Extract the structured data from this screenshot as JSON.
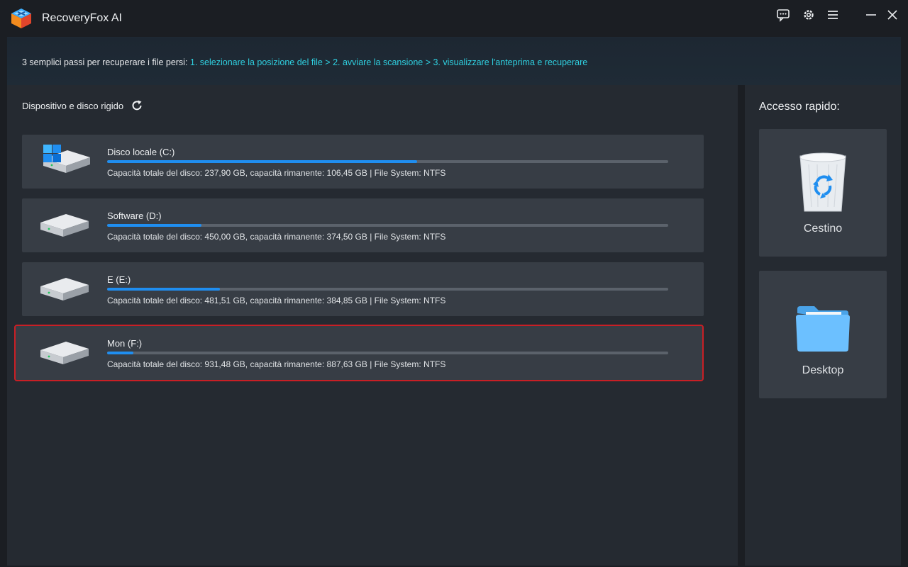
{
  "app": {
    "title": "RecoveryFox AI"
  },
  "titlebar": {
    "icons": [
      "feedback-icon",
      "gear-icon",
      "menu-icon",
      "minimize-icon",
      "close-icon"
    ]
  },
  "banner": {
    "prefix": "3 semplici passi per recuperare i file persi: ",
    "steps": "1. selezionare la posizione del file > 2. avviare la scansione > 3. visualizzare l'anteprima e recuperare"
  },
  "devices": {
    "title": "Dispositivo e disco rigido",
    "drives": [
      {
        "name": "Disco locale (C:)",
        "info": "Capacità totale del disco: 237,90 GB, capacità rimanente: 106,45 GB | File System: NTFS",
        "used_fraction": 0.5525,
        "icon": "windows-drive-icon",
        "selected": false
      },
      {
        "name": "Software (D:)",
        "info": "Capacità totale del disco: 450,00 GB, capacità rimanente: 374,50 GB | File System: NTFS",
        "used_fraction": 0.1678,
        "icon": "hard-drive-icon",
        "selected": false
      },
      {
        "name": "E (E:)",
        "info": "Capacità totale del disco: 481,51 GB, capacità rimanente: 384,85 GB | File System: NTFS",
        "used_fraction": 0.2007,
        "icon": "hard-drive-icon",
        "selected": false
      },
      {
        "name": "Mon (F:)",
        "info": "Capacità totale del disco: 931,48 GB, capacità rimanente: 887,63 GB | File System: NTFS",
        "used_fraction": 0.0471,
        "icon": "hard-drive-icon",
        "selected": true
      }
    ]
  },
  "quick_access": {
    "title": "Accesso rapido:",
    "items": [
      {
        "label": "Cestino",
        "icon": "recycle-bin-icon"
      },
      {
        "label": "Desktop",
        "icon": "folder-icon"
      }
    ]
  },
  "colors": {
    "accent": "#1f8ef0",
    "steps_text": "#2fd0e0",
    "selection_border": "#c91f25",
    "card_bg": "#373d45",
    "panel_bg": "#252a31"
  }
}
